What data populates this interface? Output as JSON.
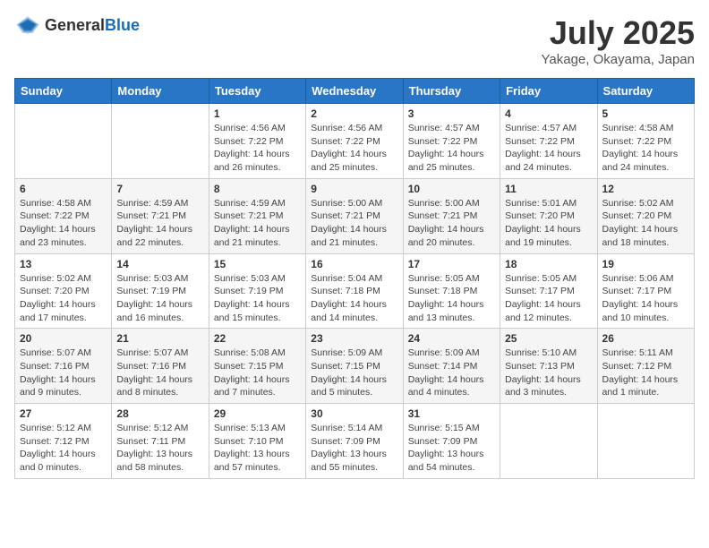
{
  "logo": {
    "text_general": "General",
    "text_blue": "Blue"
  },
  "title": "July 2025",
  "location": "Yakage, Okayama, Japan",
  "weekdays": [
    "Sunday",
    "Monday",
    "Tuesday",
    "Wednesday",
    "Thursday",
    "Friday",
    "Saturday"
  ],
  "weeks": [
    [
      {
        "day": "",
        "info": ""
      },
      {
        "day": "",
        "info": ""
      },
      {
        "day": "1",
        "info": "Sunrise: 4:56 AM\nSunset: 7:22 PM\nDaylight: 14 hours and 26 minutes."
      },
      {
        "day": "2",
        "info": "Sunrise: 4:56 AM\nSunset: 7:22 PM\nDaylight: 14 hours and 25 minutes."
      },
      {
        "day": "3",
        "info": "Sunrise: 4:57 AM\nSunset: 7:22 PM\nDaylight: 14 hours and 25 minutes."
      },
      {
        "day": "4",
        "info": "Sunrise: 4:57 AM\nSunset: 7:22 PM\nDaylight: 14 hours and 24 minutes."
      },
      {
        "day": "5",
        "info": "Sunrise: 4:58 AM\nSunset: 7:22 PM\nDaylight: 14 hours and 24 minutes."
      }
    ],
    [
      {
        "day": "6",
        "info": "Sunrise: 4:58 AM\nSunset: 7:22 PM\nDaylight: 14 hours and 23 minutes."
      },
      {
        "day": "7",
        "info": "Sunrise: 4:59 AM\nSunset: 7:21 PM\nDaylight: 14 hours and 22 minutes."
      },
      {
        "day": "8",
        "info": "Sunrise: 4:59 AM\nSunset: 7:21 PM\nDaylight: 14 hours and 21 minutes."
      },
      {
        "day": "9",
        "info": "Sunrise: 5:00 AM\nSunset: 7:21 PM\nDaylight: 14 hours and 21 minutes."
      },
      {
        "day": "10",
        "info": "Sunrise: 5:00 AM\nSunset: 7:21 PM\nDaylight: 14 hours and 20 minutes."
      },
      {
        "day": "11",
        "info": "Sunrise: 5:01 AM\nSunset: 7:20 PM\nDaylight: 14 hours and 19 minutes."
      },
      {
        "day": "12",
        "info": "Sunrise: 5:02 AM\nSunset: 7:20 PM\nDaylight: 14 hours and 18 minutes."
      }
    ],
    [
      {
        "day": "13",
        "info": "Sunrise: 5:02 AM\nSunset: 7:20 PM\nDaylight: 14 hours and 17 minutes."
      },
      {
        "day": "14",
        "info": "Sunrise: 5:03 AM\nSunset: 7:19 PM\nDaylight: 14 hours and 16 minutes."
      },
      {
        "day": "15",
        "info": "Sunrise: 5:03 AM\nSunset: 7:19 PM\nDaylight: 14 hours and 15 minutes."
      },
      {
        "day": "16",
        "info": "Sunrise: 5:04 AM\nSunset: 7:18 PM\nDaylight: 14 hours and 14 minutes."
      },
      {
        "day": "17",
        "info": "Sunrise: 5:05 AM\nSunset: 7:18 PM\nDaylight: 14 hours and 13 minutes."
      },
      {
        "day": "18",
        "info": "Sunrise: 5:05 AM\nSunset: 7:17 PM\nDaylight: 14 hours and 12 minutes."
      },
      {
        "day": "19",
        "info": "Sunrise: 5:06 AM\nSunset: 7:17 PM\nDaylight: 14 hours and 10 minutes."
      }
    ],
    [
      {
        "day": "20",
        "info": "Sunrise: 5:07 AM\nSunset: 7:16 PM\nDaylight: 14 hours and 9 minutes."
      },
      {
        "day": "21",
        "info": "Sunrise: 5:07 AM\nSunset: 7:16 PM\nDaylight: 14 hours and 8 minutes."
      },
      {
        "day": "22",
        "info": "Sunrise: 5:08 AM\nSunset: 7:15 PM\nDaylight: 14 hours and 7 minutes."
      },
      {
        "day": "23",
        "info": "Sunrise: 5:09 AM\nSunset: 7:15 PM\nDaylight: 14 hours and 5 minutes."
      },
      {
        "day": "24",
        "info": "Sunrise: 5:09 AM\nSunset: 7:14 PM\nDaylight: 14 hours and 4 minutes."
      },
      {
        "day": "25",
        "info": "Sunrise: 5:10 AM\nSunset: 7:13 PM\nDaylight: 14 hours and 3 minutes."
      },
      {
        "day": "26",
        "info": "Sunrise: 5:11 AM\nSunset: 7:12 PM\nDaylight: 14 hours and 1 minute."
      }
    ],
    [
      {
        "day": "27",
        "info": "Sunrise: 5:12 AM\nSunset: 7:12 PM\nDaylight: 14 hours and 0 minutes."
      },
      {
        "day": "28",
        "info": "Sunrise: 5:12 AM\nSunset: 7:11 PM\nDaylight: 13 hours and 58 minutes."
      },
      {
        "day": "29",
        "info": "Sunrise: 5:13 AM\nSunset: 7:10 PM\nDaylight: 13 hours and 57 minutes."
      },
      {
        "day": "30",
        "info": "Sunrise: 5:14 AM\nSunset: 7:09 PM\nDaylight: 13 hours and 55 minutes."
      },
      {
        "day": "31",
        "info": "Sunrise: 5:15 AM\nSunset: 7:09 PM\nDaylight: 13 hours and 54 minutes."
      },
      {
        "day": "",
        "info": ""
      },
      {
        "day": "",
        "info": ""
      }
    ]
  ]
}
